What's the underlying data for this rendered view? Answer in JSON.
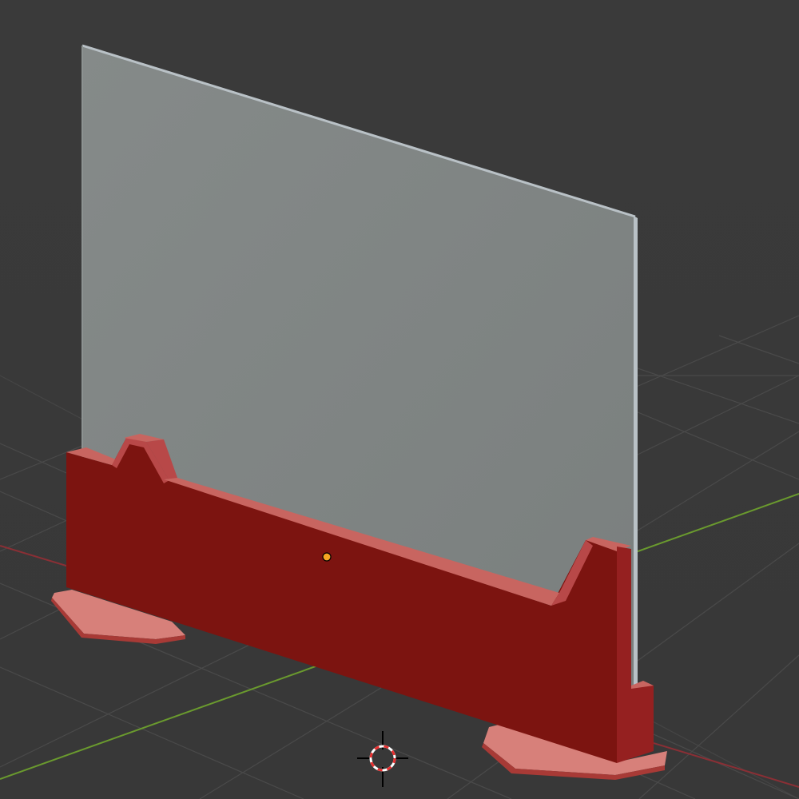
{
  "viewport": {
    "background": "#393939",
    "grid_color": "#4a4a4a",
    "x_axis_color": "#8a2f35",
    "y_axis_color": "#6a9a2e"
  },
  "objects": {
    "display_panel": {
      "face_color": "#7e8382",
      "edge_color": "#b9c1c6"
    },
    "base_stand": {
      "front_color": "#7c1410",
      "top_color": "#c86560",
      "side_color": "#952020",
      "foot_color": "#d7807a"
    }
  },
  "origin_marker": {
    "color": "#f5a623"
  },
  "cursor_3d": {
    "ring_color_a": "#e83030",
    "ring_color_b": "#ffffff"
  }
}
